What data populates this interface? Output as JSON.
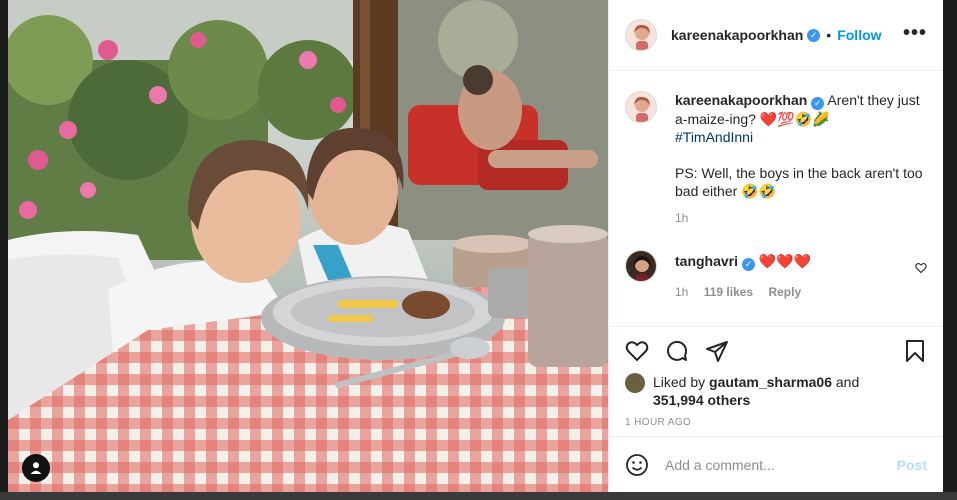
{
  "post": {
    "author": "kareenakapoorkhan",
    "follow_label": "Follow",
    "more_label": "•••",
    "caption_text": "Aren't they just a-maize-ing? ",
    "caption_emojis": "❤️💯🤣🌽",
    "hashtag": "#TimAndInni",
    "caption_ps": "PS: Well, the boys in the back aren't too bad either 🤣🤣",
    "caption_time": "1h"
  },
  "comments": [
    {
      "author": "tanghavri",
      "text": "❤️❤️❤️",
      "time": "1h",
      "likes": "119 likes",
      "reply_label": "Reply"
    }
  ],
  "likes": {
    "prefix": "Liked by ",
    "user": "gautam_sharma06",
    "middle": " and",
    "count": "351,994 others"
  },
  "timestamp": "1 HOUR AGO",
  "composer": {
    "placeholder": "Add a comment...",
    "post_label": "Post"
  },
  "icons": [
    "user-tag-icon",
    "verified-icon",
    "more-icon",
    "heart-icon",
    "comment-icon",
    "share-icon",
    "bookmark-icon",
    "emoji-icon"
  ],
  "colors": {
    "accent": "#0095f6",
    "verified": "#3897f0",
    "text": "#262626",
    "muted": "#8e8e8e",
    "post_disabled": "#b2dffc"
  }
}
